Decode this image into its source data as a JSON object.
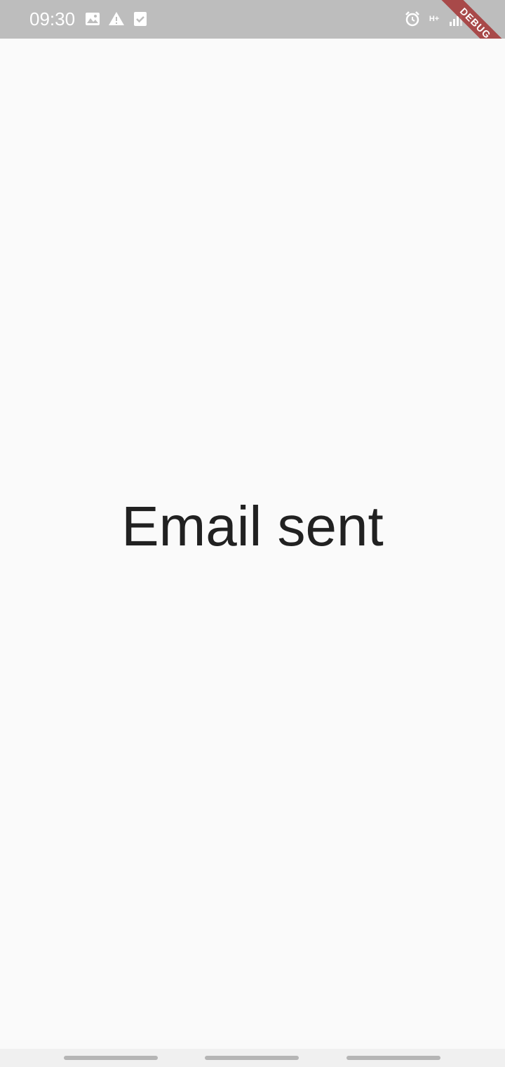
{
  "status_bar": {
    "time": "09:30",
    "left_icons": [
      "image-icon",
      "warning-icon",
      "task-check-icon"
    ],
    "right_icons": [
      "alarm-icon",
      "network-type-icon",
      "signal-icon",
      "battery-icon"
    ],
    "network_type": "H+",
    "background_color": "#bdbdbd"
  },
  "debug_banner": {
    "label": "DEBUG",
    "color": "#a12828"
  },
  "main": {
    "message": "Email sent",
    "background_color": "#fafafa",
    "text_color": "#212121"
  },
  "nav_bar": {
    "handles": [
      "nav-handle-left",
      "nav-handle-center",
      "nav-handle-right"
    ]
  }
}
